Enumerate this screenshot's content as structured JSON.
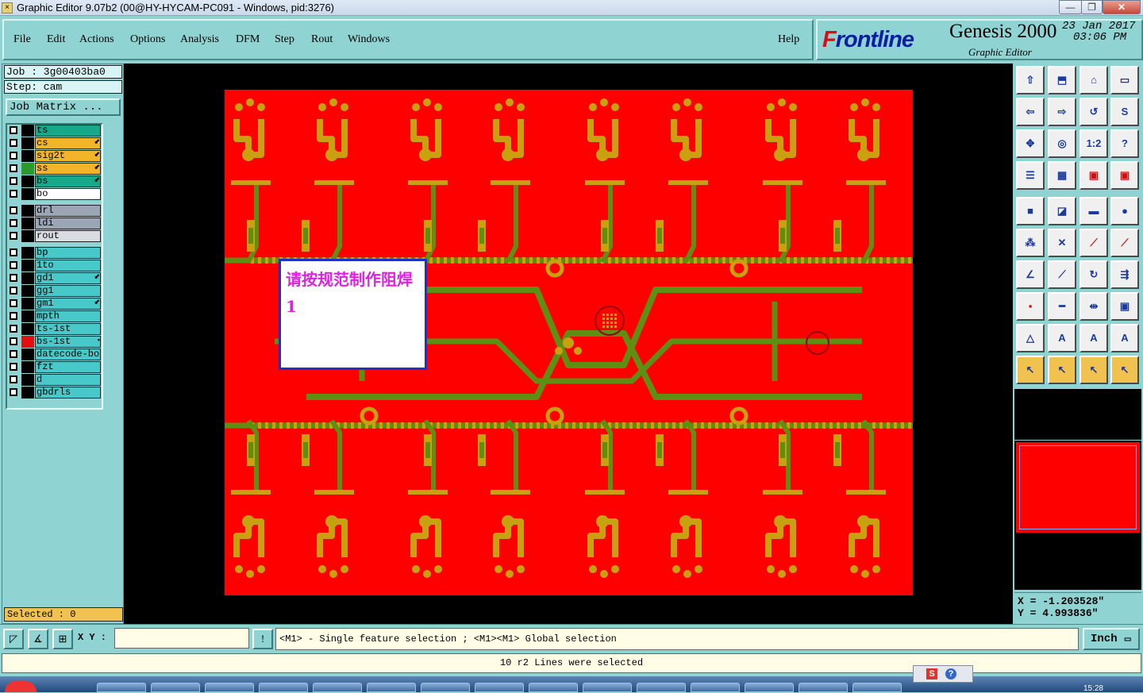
{
  "window": {
    "title": "Graphic Editor 9.07b2 (00@HY-HYCAM-PC091 - Windows, pid:3276)"
  },
  "menu": [
    "File",
    "Edit",
    "Actions",
    "Options",
    "Analysis",
    "DFM",
    "Step",
    "Rout",
    "Windows"
  ],
  "help_label": "Help",
  "brand": {
    "logo_a": "F",
    "logo_b": "rontline",
    "product": "Genesis 2000",
    "sub": "Graphic Editor",
    "date": "23 Jan 2017",
    "time": "03:06 PM"
  },
  "job": {
    "job_line": "Job : 3g00403ba0",
    "step_line": "Step: cam",
    "matrix_btn": "Job Matrix ..."
  },
  "layers": [
    {
      "name": "ts",
      "color": "#17a88a",
      "sw": "#000000",
      "mark": ""
    },
    {
      "name": "cs",
      "color": "#f2b52a",
      "sw": "#000000",
      "mark": "⬋"
    },
    {
      "name": "sig2t",
      "color": "#f2b52a",
      "sw": "#000000",
      "mark": "⬋"
    },
    {
      "name": "ss",
      "color": "#f2b52a",
      "sw": "#2a9a2a",
      "mark": "⬋"
    },
    {
      "name": "bs",
      "color": "#17a88a",
      "sw": "#000000",
      "mark": "⬋"
    },
    {
      "name": "bo",
      "color": "#ffffff",
      "sw": "#000000",
      "mark": ""
    },
    {
      "name": "drl",
      "color": "#9aa6b4",
      "sw": "#000000",
      "mark": ""
    },
    {
      "name": "ldi",
      "color": "#9aa6b4",
      "sw": "#000000",
      "mark": ""
    },
    {
      "name": "rout",
      "color": "#d8dde2",
      "sw": "#000000",
      "mark": ""
    },
    {
      "name": "bp",
      "color": "#48c8c8",
      "sw": "#000000",
      "mark": ""
    },
    {
      "name": "1to",
      "color": "#48c8c8",
      "sw": "#000000",
      "mark": ""
    },
    {
      "name": "gd1",
      "color": "#48c8c8",
      "sw": "#000000",
      "mark": "⬋"
    },
    {
      "name": "gg1",
      "color": "#48c8c8",
      "sw": "#000000",
      "mark": ""
    },
    {
      "name": "gm1",
      "color": "#48c8c8",
      "sw": "#000000",
      "mark": "⬋"
    },
    {
      "name": "mpth",
      "color": "#48c8c8",
      "sw": "#000000",
      "mark": ""
    },
    {
      "name": "ts-1st",
      "color": "#48c8c8",
      "sw": "#000000",
      "mark": ""
    },
    {
      "name": "bs-1st",
      "color": "#48c8c8",
      "sw": "#e01010",
      "mark": "▪"
    },
    {
      "name": "datecode-bo",
      "color": "#48c8c8",
      "sw": "#000000",
      "mark": ""
    },
    {
      "name": "fzt",
      "color": "#48c8c8",
      "sw": "#000000",
      "mark": ""
    },
    {
      "name": "d",
      "color": "#48c8c8",
      "sw": "#000000",
      "mark": ""
    },
    {
      "name": "gbdrls",
      "color": "#48c8c8",
      "sw": "#000000",
      "mark": ""
    }
  ],
  "selected": "Selected : 0",
  "note": "请按规范制作阻焊1",
  "coords": {
    "x": "X = -1.203528\"",
    "y": "Y = 4.993836\""
  },
  "command": {
    "xy_label": "X Y :",
    "xy_value": "",
    "excl": "!",
    "message": "<M1> - Single feature selection ; <M1><M1> Global selection",
    "unit": "Inch"
  },
  "status": "10 r2 Lines were selected",
  "toolbar": [
    [
      "⇧",
      "⬒",
      "⌂",
      "▭"
    ],
    [
      "⇦",
      "⇨",
      "↺",
      "S"
    ],
    [
      "✥",
      "◎",
      "1:2",
      "?"
    ],
    [
      "☰",
      "▦",
      "▣",
      "▣"
    ],
    [
      "■",
      "◪",
      "▬",
      "●"
    ],
    [
      "⁂",
      "✕",
      "⟋",
      "⟋"
    ],
    [
      "∠",
      "⟋",
      "↻",
      "⇶"
    ],
    [
      "▪",
      "━",
      "⇹",
      "▣"
    ],
    [
      "△",
      "A",
      "A",
      "A"
    ],
    [
      "↖",
      "↖",
      "↖",
      "↖"
    ]
  ],
  "clock": "15:28",
  "colors": {
    "panel": "#8fd3d3",
    "board": "#ff0000",
    "trace": "#5e8f12",
    "pad": "#c8a010"
  }
}
